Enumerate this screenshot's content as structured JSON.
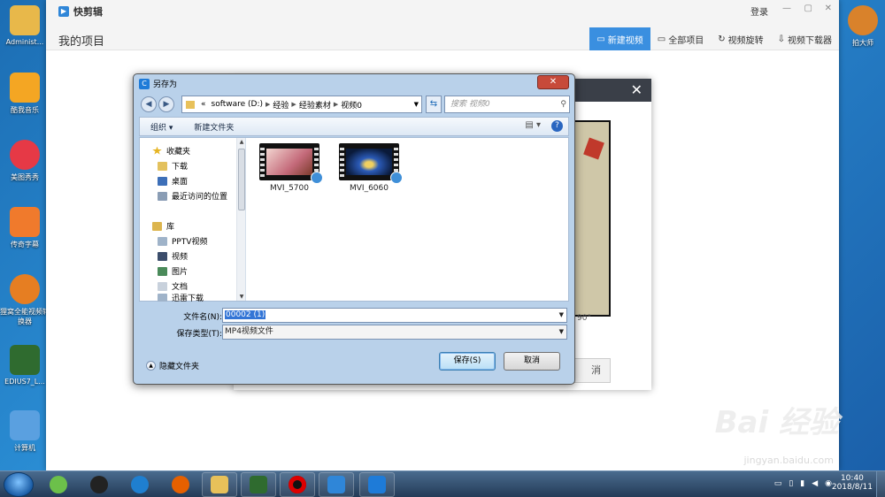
{
  "desktop": {
    "left_icons": [
      {
        "label": "Administ...",
        "color": "#e8b84a"
      },
      {
        "label": "酷我音乐",
        "color": "#f4a623"
      },
      {
        "label": "美图秀秀",
        "color": "#e63946"
      },
      {
        "label": "传奇字幕",
        "color": "#f07a2c"
      },
      {
        "label": "狸窝全能视频转换器",
        "color": "#e67e22"
      },
      {
        "label": "EDIUS7_L...",
        "color": "#2f6b2f"
      },
      {
        "label": "计算机",
        "color": "#5aa0e0"
      }
    ],
    "right_icons": [
      {
        "label": "拍大师",
        "color": "#d9822b"
      }
    ]
  },
  "app": {
    "title": "快剪辑",
    "login": "登录",
    "page_title": "我的项目",
    "tabs": [
      {
        "label": "新建视频",
        "icon": "video-icon",
        "active": true
      },
      {
        "label": "全部项目",
        "icon": "folder-icon",
        "active": false
      },
      {
        "label": "视频旋转",
        "icon": "rotate-icon",
        "active": false
      },
      {
        "label": "视频下载器",
        "icon": "download-icon",
        "active": false
      }
    ],
    "bg_dialog": {
      "degree_label": "90°",
      "cancel_label": "消"
    }
  },
  "save_dialog": {
    "title": "另存为",
    "breadcrumb": [
      "«",
      "software (D:)",
      "经验",
      "经验素材",
      "视频0"
    ],
    "search_placeholder": "搜索 视频0",
    "commands": {
      "organize": "组织 ▾",
      "new_folder": "新建文件夹"
    },
    "nav": {
      "favorites_header": "收藏夹",
      "favorites": [
        "下载",
        "桌面",
        "最近访问的位置"
      ],
      "libraries_header": "库",
      "libraries": [
        "PPTV视频",
        "视频",
        "图片",
        "文档",
        "迅雷下载"
      ]
    },
    "files": [
      {
        "name": "MVI_5700",
        "thumb_color": "#d39a9c"
      },
      {
        "name": "MVI_6060",
        "thumb_color": "#2b5bb8"
      }
    ],
    "filename_label": "文件名(N):",
    "filename_value": "00002 (1)",
    "filetype_label": "保存类型(T):",
    "filetype_value": "MP4视频文件",
    "hide_folders": "隐藏文件夹",
    "save_button": "保存(S)",
    "cancel_button": "取消"
  },
  "taskbar": {
    "clock_time": "10:40",
    "clock_date": "2018/8/11"
  },
  "watermark": {
    "main": "Bai 经验",
    "url": "jingyan.baidu.com"
  }
}
